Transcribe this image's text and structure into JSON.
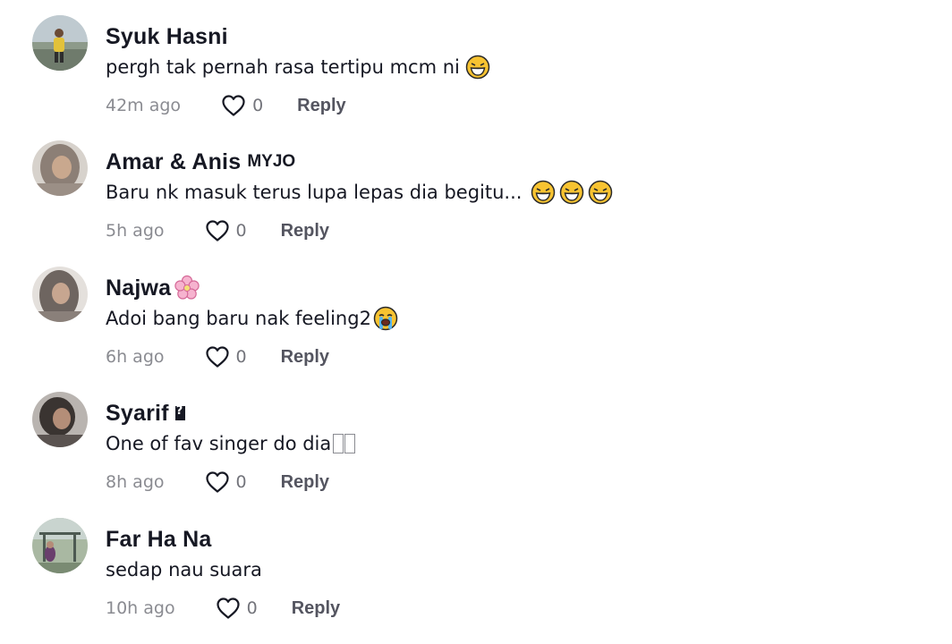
{
  "comments": [
    {
      "username": "Syuk Hasni",
      "text": "pergh tak pernah rasa tertipu mcm ni",
      "emojis": [
        "laughing-tears-emoji"
      ],
      "time": "42m ago",
      "likes": "0",
      "reply_label": "Reply"
    },
    {
      "username": "Amar & Anis",
      "tag": "MYJO",
      "text": "Baru nk masuk terus lupa lepas dia begitu...",
      "emojis": [
        "laughing-tears-emoji",
        "laughing-tears-emoji",
        "laughing-tears-emoji"
      ],
      "time": "5h ago",
      "likes": "0",
      "reply_label": "Reply"
    },
    {
      "username": "Najwa",
      "name_emoji": "cherry-blossom-emoji",
      "text": "Adoi bang baru nak feeling2",
      "emojis": [
        "loudly-crying-emoji"
      ],
      "time": "6h ago",
      "likes": "0",
      "reply_label": "Reply"
    },
    {
      "username": "Syarif",
      "name_emoji": "missing-glyph",
      "text": "One of fav singer do dia",
      "text_suffix_icon": "missing-glyph-boxes",
      "time": "8h ago",
      "likes": "0",
      "reply_label": "Reply"
    },
    {
      "username": "Far Ha Na",
      "text": "sedap nau suara",
      "time": "10h ago",
      "likes": "0",
      "reply_label": "Reply"
    }
  ],
  "icons": {
    "like": "heart-outline-icon"
  },
  "colors": {
    "text_primary": "#161823",
    "text_secondary": "#8a8b91",
    "reply": "#545560",
    "emoji_yellow": "#f7c331"
  }
}
